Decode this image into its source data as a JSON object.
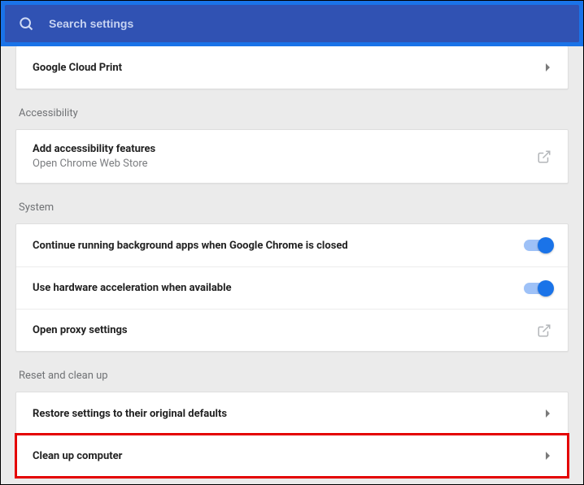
{
  "search": {
    "placeholder": "Search settings"
  },
  "sections": {
    "printing": {
      "google_cloud_print": "Google Cloud Print"
    },
    "accessibility": {
      "label": "Accessibility",
      "add_features_title": "Add accessibility features",
      "add_features_sub": "Open Chrome Web Store"
    },
    "system": {
      "label": "System",
      "continue_bg": "Continue running background apps when Google Chrome is closed",
      "hw_accel": "Use hardware acceleration when available",
      "proxy": "Open proxy settings"
    },
    "reset": {
      "label": "Reset and clean up",
      "restore": "Restore settings to their original defaults",
      "cleanup": "Clean up computer"
    }
  }
}
